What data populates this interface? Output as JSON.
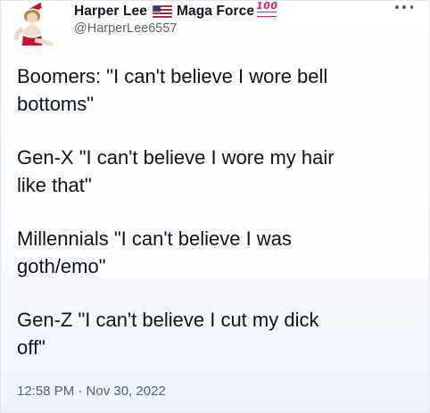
{
  "author": {
    "display_name": "Harper Lee",
    "display_suffix": "Maga Force",
    "badge_text": "100",
    "handle": "@HarperLee6557",
    "flag_icon": "us-flag-icon",
    "badge_icon": "hundred-points-icon",
    "avatar": "pinup-avatar"
  },
  "tweet": {
    "paragraphs": [
      "Boomers: \"I can't believe I wore bell\nbottoms\"",
      "Gen-X \"I can't believe I wore my hair\nlike that\"",
      "Millennials \"I can't believe I was\ngoth/emo\"",
      "Gen-Z \"I can't believe I cut my dick\noff\""
    ],
    "timestamp": "12:58 PM · Nov 30, 2022"
  },
  "menu": {
    "icon": "more-options-icon"
  },
  "colors": {
    "text": "#0f1419",
    "muted": "#536471",
    "badge": "#e0245e"
  }
}
